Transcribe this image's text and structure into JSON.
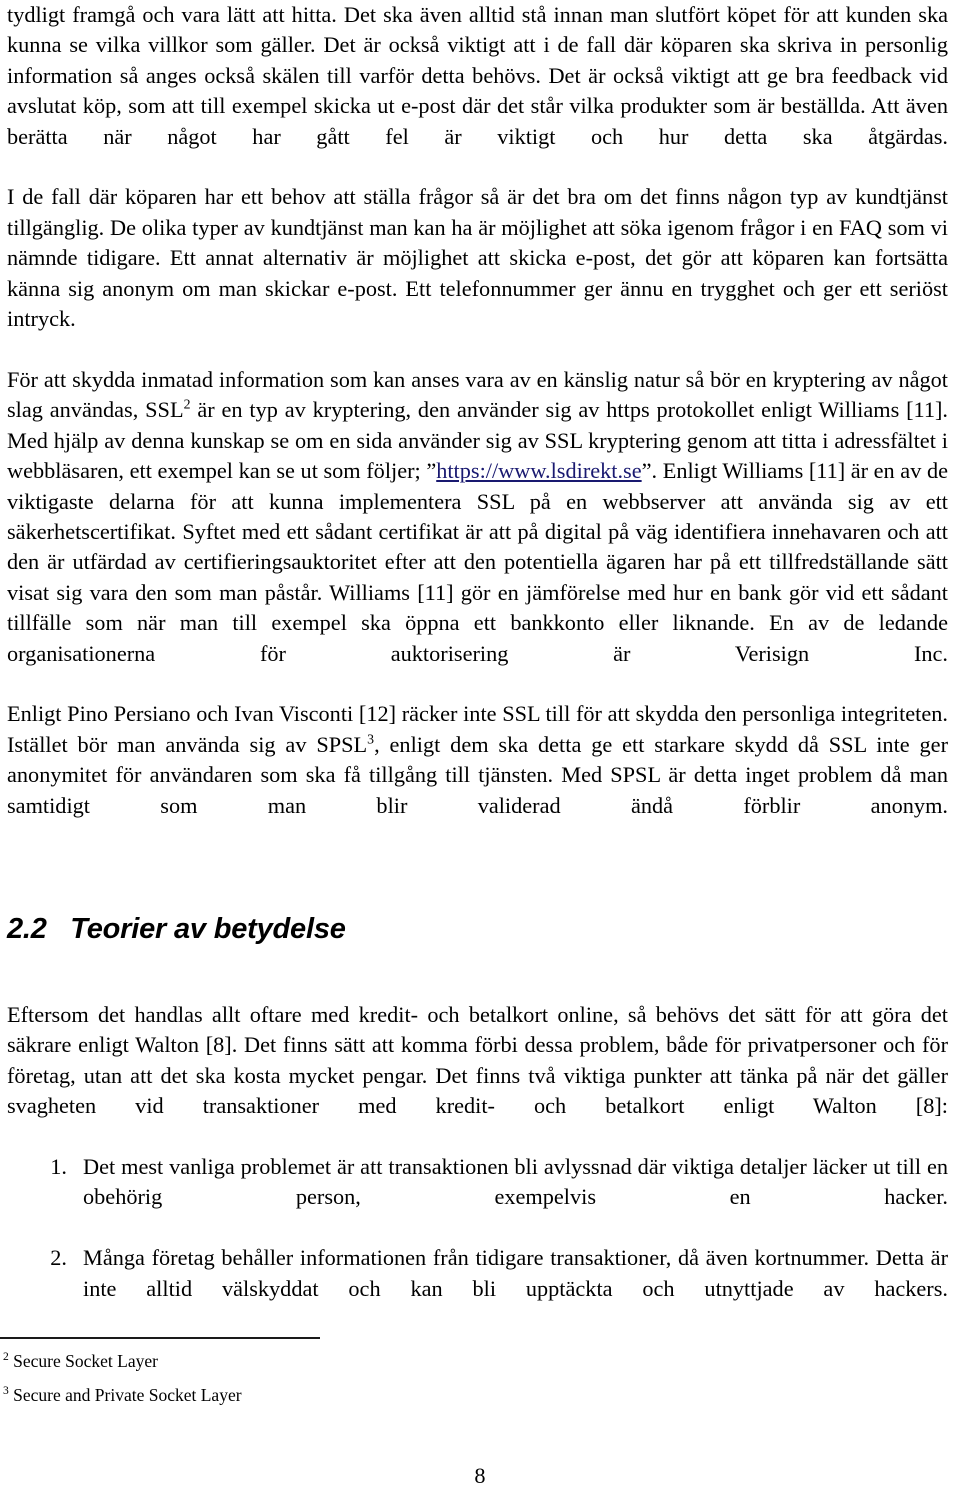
{
  "document": {
    "page_number": "8",
    "language": "sv"
  },
  "body": {
    "paragraphs": [
      {
        "id": "p1",
        "text": "tydligt framgå och vara lätt att hitta. Det ska även alltid stå innan man slutfört köpet för att kunden ska kunna se vilka villkor som gäller. Det är också viktigt att i de fall där köparen ska skriva in personlig information så anges också skälen till varför detta behövs. Det är också viktigt att ge bra feedback vid avslutat köp, som att till exempel skicka ut e-post där det står vilka produkter som är beställda. Att även berätta när något har gått fel är viktigt och hur detta ska åtgärdas."
      },
      {
        "id": "p2",
        "text": "I de fall där köparen har ett behov att ställa frågor så är det bra om det finns någon typ av kundtjänst tillgänglig. De olika typer av kundtjänst man kan ha är möjlighet att söka igenom frågor i en FAQ som vi nämnde tidigare. Ett annat alternativ är möjlighet att skicka e-post, det gör att köparen kan fortsätta känna sig anonym om man skickar e-post. Ett telefonnummer ger ännu en trygghet och ger ett seriöst intryck."
      },
      {
        "id": "p3a",
        "text": "För att skydda inmatad information som kan anses vara av en känslig natur så bör en kryptering av något slag användas, SSL"
      },
      {
        "id": "p3_sup",
        "text": "2"
      },
      {
        "id": "p3b",
        "text": " är en typ av kryptering, den använder sig av https protokollet enligt Williams [11]. Med hjälp av denna kunskap se om en sida använder sig av SSL kryptering genom att titta i adressfältet i webbläsaren, ett exempel kan se ut som följer; ”"
      },
      {
        "id": "p3_link",
        "text": "https://www.lsdirekt.se"
      },
      {
        "id": "p3c",
        "text": "”. Enligt Williams [11] är en av de viktigaste delarna för att kunna implementera SSL på en webbserver att använda sig av ett säkerhetscertifikat. Syftet med ett sådant certifikat är att på digital på väg identifiera innehavaren och att den är utfärdad av certifieringsauktoritet efter att den potentiella ägaren har på ett tillfredställande sätt visat sig vara den som man påstår. Williams [11] gör en jämförelse med hur en bank gör vid ett sådant tillfälle som när man till exempel ska öppna ett bankkonto eller liknande. En av de ledande organisationerna för auktorisering är Verisign Inc."
      },
      {
        "id": "p4a",
        "text": "Enligt Pino Persiano och Ivan Visconti [12] räcker inte SSL till för att skydda den personliga integriteten. Istället bör man använda sig av SPSL"
      },
      {
        "id": "p4_sup",
        "text": "3"
      },
      {
        "id": "p4b",
        "text": ", enligt dem ska detta ge ett starkare skydd då SSL inte ger anonymitet för användaren som ska få tillgång till tjänsten. Med SPSL är detta inget problem då man samtidigt som man blir validerad ändå förblir anonym."
      }
    ]
  },
  "section": {
    "number": "2.2",
    "title": "Teorier av betydelse",
    "heading_full": "2.2   Teorier av betydelse"
  },
  "section_body": {
    "paragraph": "Eftersom det handlas allt oftare med kredit- och betalkort online, så behövs det sätt för att göra det säkrare enligt Walton [8]. Det finns sätt att komma förbi dessa problem, både för privatpersoner och för företag, utan att det ska kosta mycket pengar. Det finns två viktiga punkter att tänka på när det gäller svagheten vid transaktioner med kredit- och betalkort enligt Walton [8]:"
  },
  "list": {
    "items": [
      {
        "marker": "1.",
        "text": "Det mest vanliga problemet är att transaktionen bli avlyssnad där viktiga detaljer läcker ut till en obehörig person, exempelvis en hacker."
      },
      {
        "marker": "2.",
        "text": "Många företag behåller informationen från tidigare transaktioner, då även kortnummer. Detta är inte alltid välskyddat och kan bli upptäckta och utnyttjade av hackers."
      }
    ]
  },
  "footnotes": [
    {
      "marker": "2",
      "text": " Secure Socket Layer"
    },
    {
      "marker": "3",
      "text": " Secure and Private Socket Layer"
    }
  ],
  "colors": {
    "text": "#000000",
    "link": "#191970",
    "background": "#ffffff",
    "rule": "#1a1a1a"
  }
}
